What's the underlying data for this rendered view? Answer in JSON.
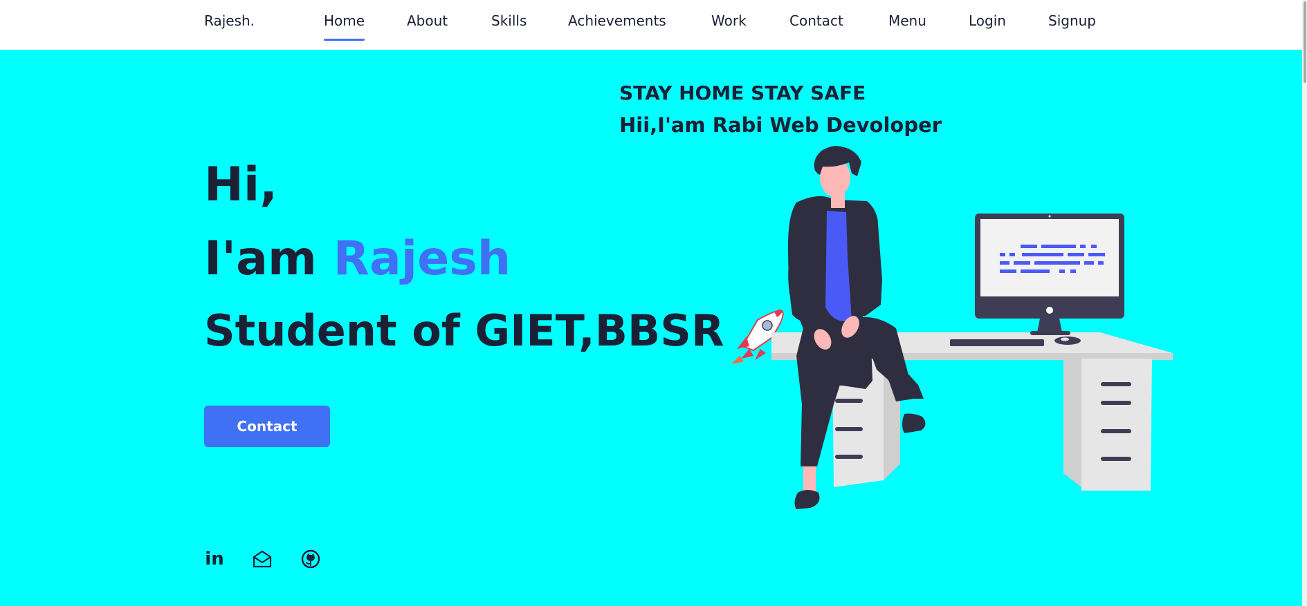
{
  "header": {
    "logo": "Rajesh.",
    "nav": [
      {
        "label": "Home",
        "active": true
      },
      {
        "label": "About"
      },
      {
        "label": "Skills"
      },
      {
        "label": "Achievements"
      },
      {
        "label": "Work"
      },
      {
        "label": "Contact"
      },
      {
        "label": "Menu"
      },
      {
        "label": "Login"
      },
      {
        "label": "Signup"
      }
    ]
  },
  "hero": {
    "tagline1": "STAY HOME STAY SAFE",
    "tagline2": "Hii,I'am Rabi Web Devoloper",
    "hi": "Hi,",
    "intro": "I'am",
    "name": "Rajesh",
    "role": "Student of GIET,BBSR",
    "cta": "Contact"
  },
  "social": [
    {
      "icon": "linkedin-icon",
      "label": "in"
    },
    {
      "icon": "mail-icon"
    },
    {
      "icon": "github-icon"
    }
  ],
  "colors": {
    "background": "#00ffff",
    "accent": "#4070f4",
    "text": "#1a2035"
  }
}
